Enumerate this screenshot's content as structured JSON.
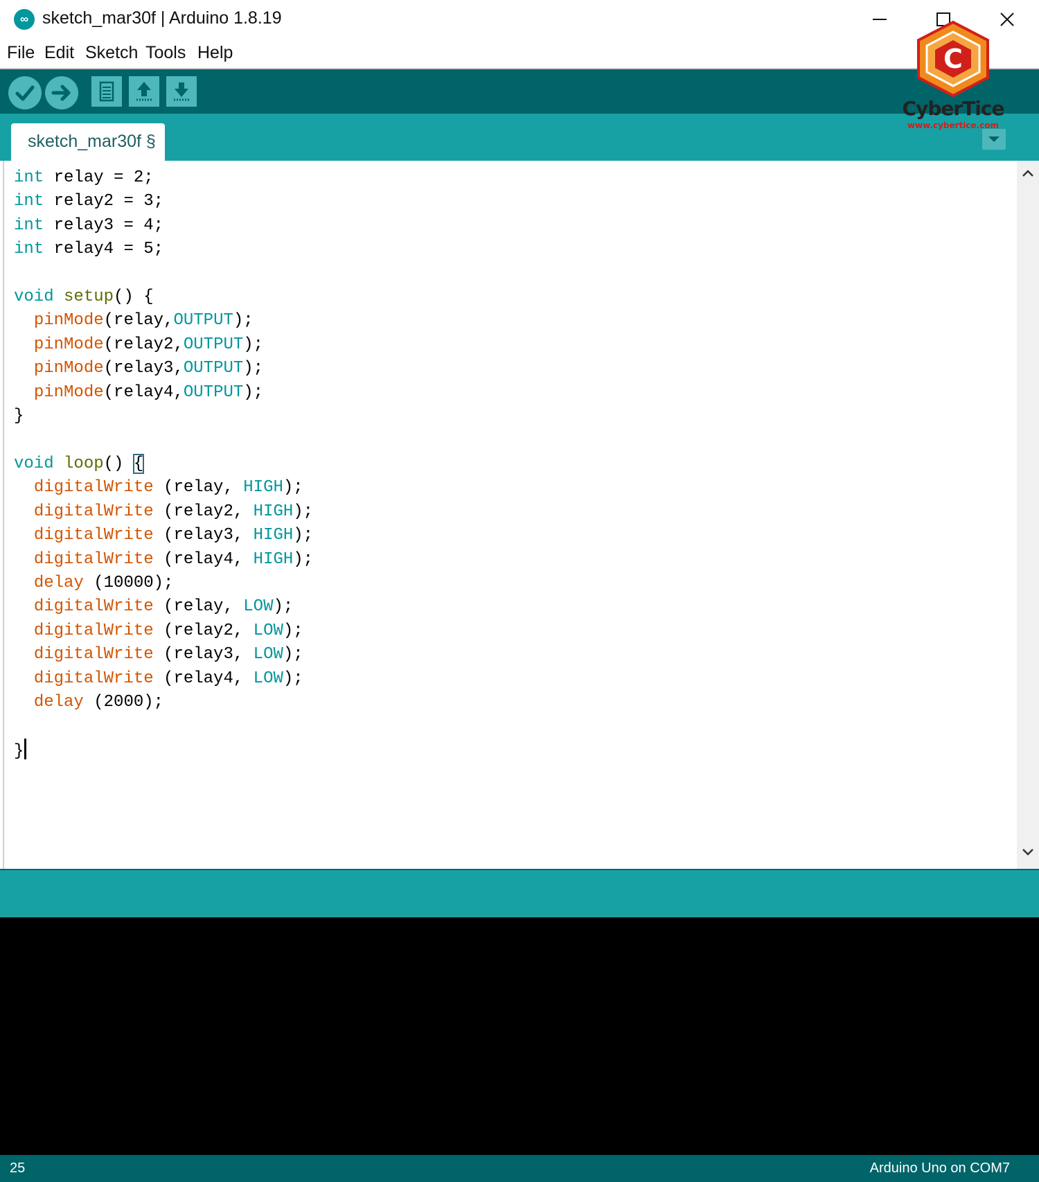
{
  "window": {
    "title": "sketch_mar30f | Arduino 1.8.19",
    "app_icon": "arduino-infinity-icon",
    "icon_glyph": "∞",
    "controls": [
      "minimize-icon",
      "maximize-icon",
      "close-icon"
    ]
  },
  "menu": {
    "file": "File",
    "edit": "Edit",
    "sketch": "Sketch",
    "tools": "Tools",
    "help": "Help"
  },
  "toolbar": {
    "buttons": [
      "verify-icon",
      "upload-icon",
      "new-icon",
      "open-icon",
      "save-icon",
      "serial-monitor-icon"
    ]
  },
  "tabs": [
    {
      "label": "sketch_mar30f §"
    }
  ],
  "code": {
    "lines": [
      "int relay = 2;",
      "int relay2 = 3;",
      "int relay3 = 4;",
      "int relay4 = 5;",
      "",
      "void setup() {",
      "  pinMode(relay,OUTPUT);",
      "  pinMode(relay2,OUTPUT);",
      "  pinMode(relay3,OUTPUT);",
      "  pinMode(relay4,OUTPUT);",
      "}",
      "",
      "void loop() {",
      "  digitalWrite (relay, HIGH);",
      "  digitalWrite (relay2, HIGH);",
      "  digitalWrite (relay3, HIGH);",
      "  digitalWrite (relay4, HIGH);",
      "  delay (10000);",
      "  digitalWrite (relay, LOW);",
      "  digitalWrite (relay2, LOW);",
      "  digitalWrite (relay3, LOW);",
      "  digitalWrite (relay4, LOW);",
      "  delay (2000);",
      "",
      "}"
    ],
    "highlight_bracket_line": 12
  },
  "status": {
    "line_number": "25",
    "board": "Arduino Uno on COM7"
  },
  "watermark": {
    "name": "CyberTice",
    "url": "www.cybertice.com",
    "logo_letter": "C"
  },
  "colors": {
    "toolbar": "#006468",
    "tabbar": "#17a1a5",
    "keyword": "#00979c",
    "function": "#d35400",
    "console": "#000000"
  }
}
